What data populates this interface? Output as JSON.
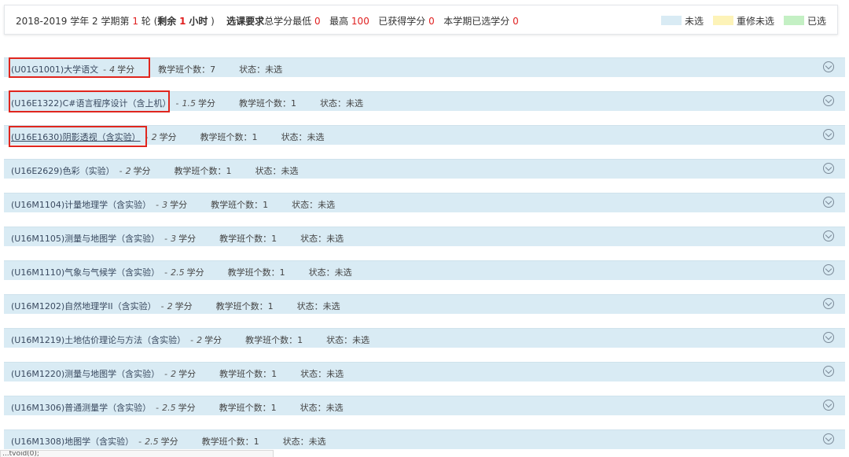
{
  "header": {
    "term": "2018-2019 学年 2 学期第",
    "round_num": "1",
    "round_unit": "轮 (",
    "remaining_label": "剩余",
    "remaining_num": "1",
    "remaining_unit": "小时",
    "close_paren": ")",
    "req_label": "选课要求",
    "min_label": "总学分最低",
    "min_value": "0",
    "max_label": "最高",
    "max_value": "100",
    "earned_label": "已获得学分",
    "earned_value": "0",
    "selected_label": "本学期已选学分",
    "selected_value": "0"
  },
  "legend": [
    {
      "label": "未选",
      "color": "#d9ebf4"
    },
    {
      "label": "重修未选",
      "color": "#fdf3b8"
    },
    {
      "label": "已选",
      "color": "#c4f0c4"
    }
  ],
  "courses": [
    {
      "title": "(U01G1001)大学语文",
      "credit": "4",
      "unit": "学分",
      "count": "教学班个数：7",
      "status": "状态：未选",
      "underline": false
    },
    {
      "title": "(U16E1322)C#语言程序设计（含上机）",
      "credit": "1.5",
      "unit": "学分",
      "count": "教学班个数：1",
      "status": "状态：未选",
      "underline": false
    },
    {
      "title": "(U16E1630)阴影透视（含实验）",
      "credit": "2",
      "unit": "学分",
      "count": "教学班个数：1",
      "status": "状态：未选",
      "underline": true
    },
    {
      "title": "(U16E2629)色彩（实验）",
      "credit": "2",
      "unit": "学分",
      "count": "教学班个数：1",
      "status": "状态：未选",
      "underline": false
    },
    {
      "title": "(U16M1104)计量地理学（含实验）",
      "credit": "3",
      "unit": "学分",
      "count": "教学班个数：1",
      "status": "状态：未选",
      "underline": false
    },
    {
      "title": "(U16M1105)测量与地图学（含实验）",
      "credit": "3",
      "unit": "学分",
      "count": "教学班个数：1",
      "status": "状态：未选",
      "underline": false
    },
    {
      "title": "(U16M1110)气象与气候学（含实验）",
      "credit": "2.5",
      "unit": "学分",
      "count": "教学班个数：1",
      "status": "状态：未选",
      "underline": false
    },
    {
      "title": "(U16M1202)自然地理学II（含实验）",
      "credit": "2",
      "unit": "学分",
      "count": "教学班个数：1",
      "status": "状态：未选",
      "underline": false
    },
    {
      "title": "(U16M1219)土地估价理论与方法（含实验）",
      "credit": "2",
      "unit": "学分",
      "count": "教学班个数：1",
      "status": "状态：未选",
      "underline": false
    },
    {
      "title": "(U16M1220)测量与地图学（含实验）",
      "credit": "2",
      "unit": "学分",
      "count": "教学班个数：1",
      "status": "状态：未选",
      "underline": false
    },
    {
      "title": "(U16M1306)普通测量学（含实验）",
      "credit": "2.5",
      "unit": "学分",
      "count": "教学班个数：1",
      "status": "状态：未选",
      "underline": false
    },
    {
      "title": "(U16M1308)地图学（含实验）",
      "credit": "2.5",
      "unit": "学分",
      "count": "教学班个数：1",
      "status": "状态：未选",
      "underline": false
    }
  ],
  "statusbar_text": "...tvoid(0);"
}
